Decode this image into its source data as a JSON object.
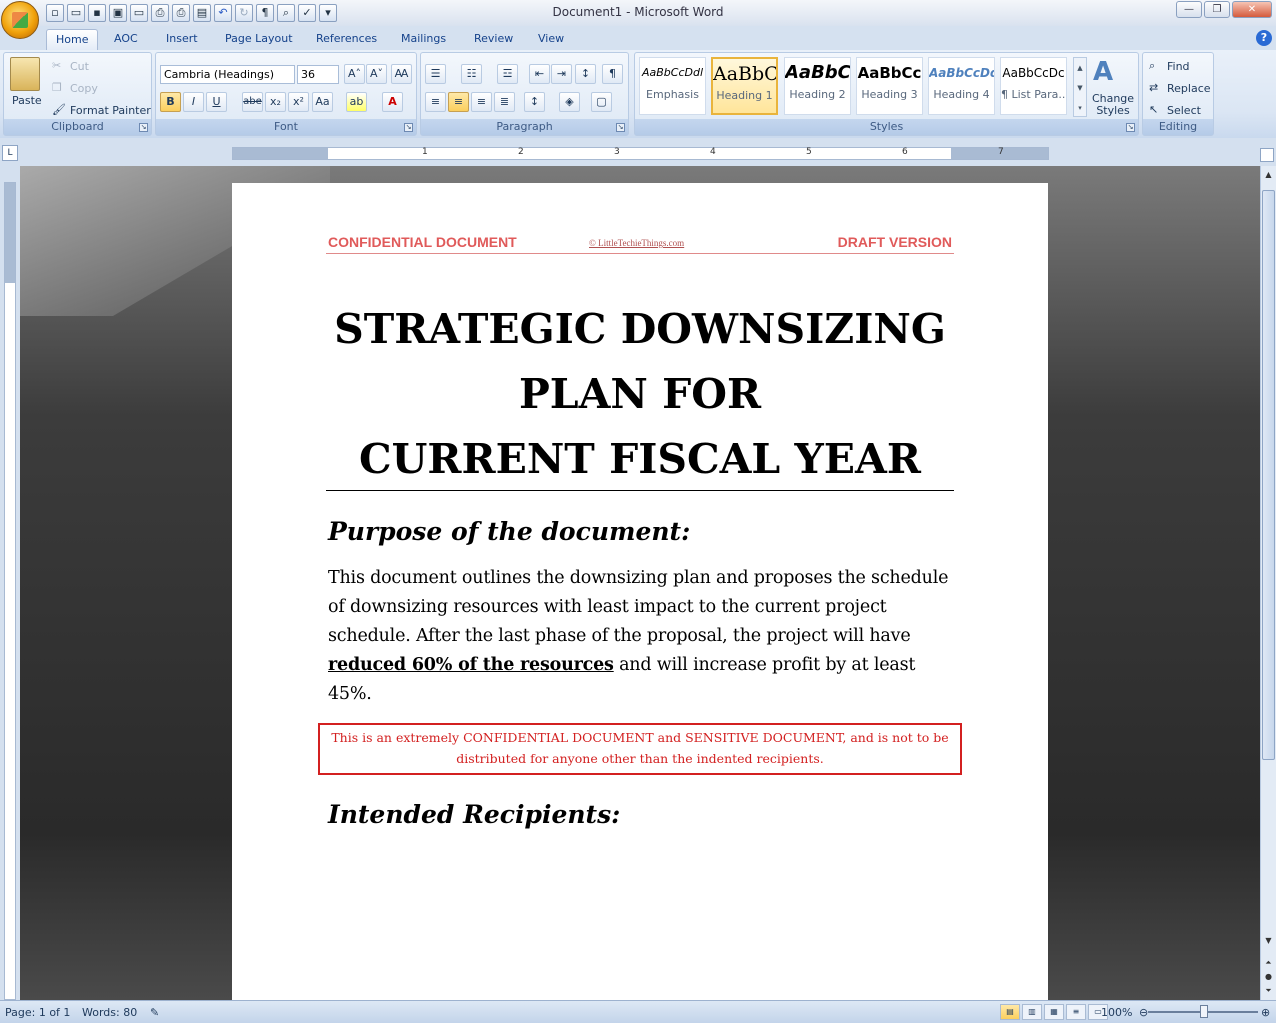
{
  "window": {
    "title": "Document1 - Microsoft Word",
    "minimize": "—",
    "maximize": "❐",
    "close": "✕"
  },
  "quick_access": [
    "new-icon",
    "open-icon",
    "save-icon",
    "saveas-icon",
    "folder-icon",
    "print-icon",
    "print-preview-icon",
    "quick-print-icon",
    "undo-icon",
    "redo-icon",
    "pilcrow-icon",
    "zoom-icon",
    "spell-icon"
  ],
  "tabs": [
    "Home",
    "AOC",
    "Insert",
    "Page Layout",
    "References",
    "Mailings",
    "Review",
    "View"
  ],
  "clipboard": {
    "paste": "Paste",
    "cut": "Cut",
    "copy": "Copy",
    "format_painter": "Format Painter",
    "label": "Clipboard"
  },
  "font": {
    "name": "Cambria (Headings)",
    "size": "36",
    "label": "Font",
    "bold": "B",
    "italic": "I",
    "underline": "U",
    "strike": "abe",
    "sub": "x₂",
    "sup": "x²",
    "case": "Aa",
    "grow": "A˄",
    "shrink": "A˅"
  },
  "paragraph": {
    "label": "Paragraph"
  },
  "styles": {
    "label": "Styles",
    "items": [
      {
        "sample": "AaBbCcDdl",
        "name": "Emphasis"
      },
      {
        "sample": "AaBbC",
        "name": "Heading 1"
      },
      {
        "sample": "AaBbC",
        "name": "Heading 2"
      },
      {
        "sample": "AaBbCc",
        "name": "Heading 3"
      },
      {
        "sample": "AaBbCcDd",
        "name": "Heading 4"
      },
      {
        "sample": "AaBbCcDc",
        "name": "¶ List Para..."
      }
    ],
    "change_styles": "Change Styles"
  },
  "editing": {
    "label": "Editing",
    "find": "Find",
    "replace": "Replace",
    "select": "Select"
  },
  "ruler": {
    "numbers": [
      "1",
      "2",
      "3",
      "4",
      "5",
      "6",
      "7"
    ]
  },
  "document": {
    "header_left": "CONFIDENTIAL DOCUMENT",
    "header_mid": "© LittleTechieThings.com",
    "header_right": "DRAFT VERSION",
    "title_lines": [
      "STRATEGIC DOWNSIZING",
      "PLAN FOR",
      "CURRENT FISCAL YEAR"
    ],
    "purpose_heading": "Purpose of the document:",
    "purpose_text_1": "This document outlines the downsizing plan and proposes the schedule of downsizing resources with least impact to the current project schedule. After the last phase of the proposal, the project will have ",
    "purpose_bold": "reduced 60% of the resources",
    "purpose_text_2": " and will increase profit by at least 45%.",
    "confidential_note": "This is an extremely CONFIDENTIAL DOCUMENT and SENSITIVE DOCUMENT, and is not to be distributed for anyone other than the indented recipients.",
    "recipients_heading": "Intended Recipients:"
  },
  "status": {
    "page": "Page: 1 of 1",
    "words": "Words: 80",
    "zoom": "100%"
  }
}
